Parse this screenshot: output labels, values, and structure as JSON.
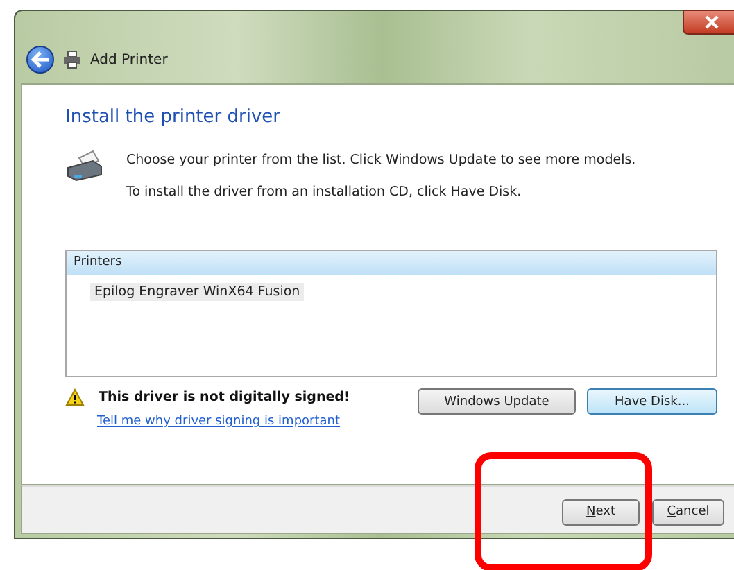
{
  "window": {
    "title": "Add Printer"
  },
  "heading": "Install the printer driver",
  "instructions": [
    "Choose your printer from the list. Click Windows Update to see more models.",
    "To install the driver from an installation CD, click Have Disk."
  ],
  "printer_list": {
    "header": "Printers",
    "items": [
      {
        "label": "Epilog Engraver WinX64 Fusion",
        "selected": true
      }
    ]
  },
  "warning": {
    "text": "This driver is not digitally signed!",
    "link": "Tell me why driver signing is important"
  },
  "buttons": [
    {
      "label": "Windows Update",
      "focused": false
    },
    {
      "label": "Have Disk...",
      "focused": true
    }
  ],
  "footer_buttons": [
    {
      "label": "Next",
      "highlighted": true
    },
    {
      "label": "Cancel",
      "highlighted": false
    }
  ]
}
